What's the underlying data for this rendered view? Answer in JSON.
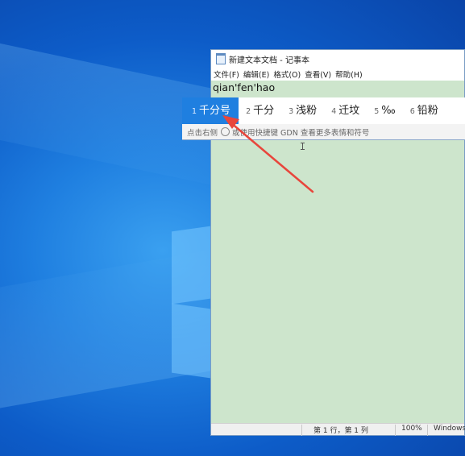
{
  "window": {
    "title": "新建文本文档 - 记事本"
  },
  "menu": [
    "文件(F)",
    "编辑(E)",
    "格式(O)",
    "查看(V)",
    "帮助(H)"
  ],
  "editor": {
    "typed": "qian'fen'hao"
  },
  "ime": {
    "candidates": [
      {
        "num": "1",
        "text": "千分号"
      },
      {
        "num": "2",
        "text": "千分"
      },
      {
        "num": "3",
        "text": "浅粉"
      },
      {
        "num": "4",
        "text": "迁坟"
      },
      {
        "num": "5",
        "text": "‰"
      },
      {
        "num": "6",
        "text": "铅粉"
      }
    ],
    "hint_left": "点击右侧",
    "hint_right": "或使用快捷键 GDN 查看更多表情和符号"
  },
  "status": {
    "position": "第 1 行，第 1 列",
    "zoom": "100%",
    "encoding": "Windows"
  },
  "colors": {
    "editor_bg": "#cde5cc",
    "ime_selected": "#1f7fe0",
    "annotation": "#e8463c"
  }
}
